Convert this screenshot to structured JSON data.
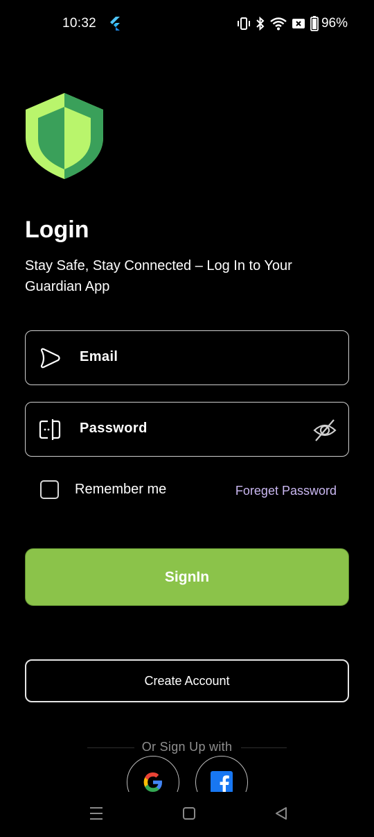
{
  "status_bar": {
    "time": "10:32",
    "battery": "96%",
    "icons": [
      "flutter-icon",
      "vibrate-icon",
      "bluetooth-icon",
      "wifi-icon",
      "no-sim-icon",
      "battery-icon"
    ]
  },
  "logo": {
    "icon": "shield-icon",
    "colors": {
      "light": "#b9f56c",
      "dark": "#3aa05a"
    }
  },
  "header": {
    "title": "Login",
    "subtitle": "Stay Safe, Stay Connected – Log In to Your Guardian App"
  },
  "form": {
    "email_placeholder": "Email",
    "email_icon": "play-arrow-icon",
    "password_placeholder": "Password",
    "password_icon": "id-card-icon",
    "password_toggle_icon": "eye-off-icon",
    "remember_label": "Remember me",
    "remember_checked": false,
    "forgot_label": "Foreget Password"
  },
  "actions": {
    "signin_label": "SignIn",
    "create_account_label": "Create Account"
  },
  "social": {
    "divider_text": "Or Sign Up with",
    "providers": [
      "google-icon",
      "facebook-icon"
    ]
  },
  "nav": {
    "icons": [
      "menu-icon",
      "home-icon",
      "back-icon"
    ]
  },
  "colors": {
    "background": "#000000",
    "accent": "#8bc34a",
    "link": "#c9b7f0",
    "border": "#cfcfcf"
  }
}
